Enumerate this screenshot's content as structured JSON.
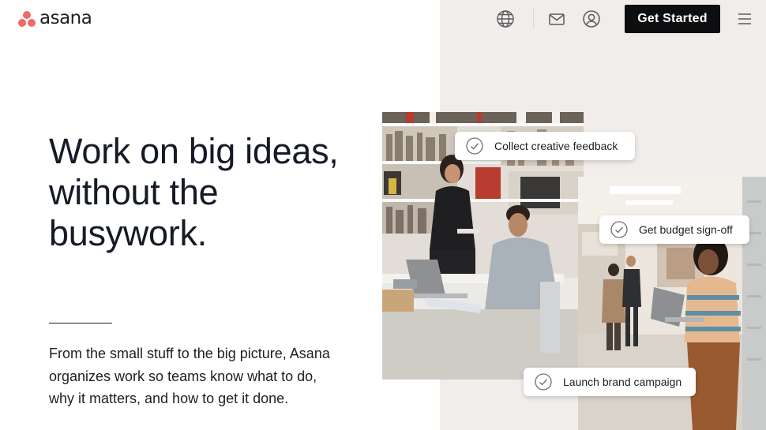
{
  "header": {
    "logo_text": "asana",
    "brand_color": "#f06a6a",
    "icons": [
      "globe-icon",
      "mail-icon",
      "user-icon",
      "menu-icon"
    ],
    "cta_label": "Get Started"
  },
  "hero": {
    "headline": "Work on big ideas, without the busywork.",
    "subtext": "From the small stuff to the big picture, Asana organizes work so teams know what to do, why it matters, and how to get it done."
  },
  "tasks": [
    {
      "label": "Collect creative feedback"
    },
    {
      "label": "Get budget sign-off"
    },
    {
      "label": "Launch brand campaign"
    }
  ],
  "colors": {
    "right_panel_bg": "#f1edeb",
    "cta_bg": "#0d0e10",
    "text": "#151b26"
  }
}
